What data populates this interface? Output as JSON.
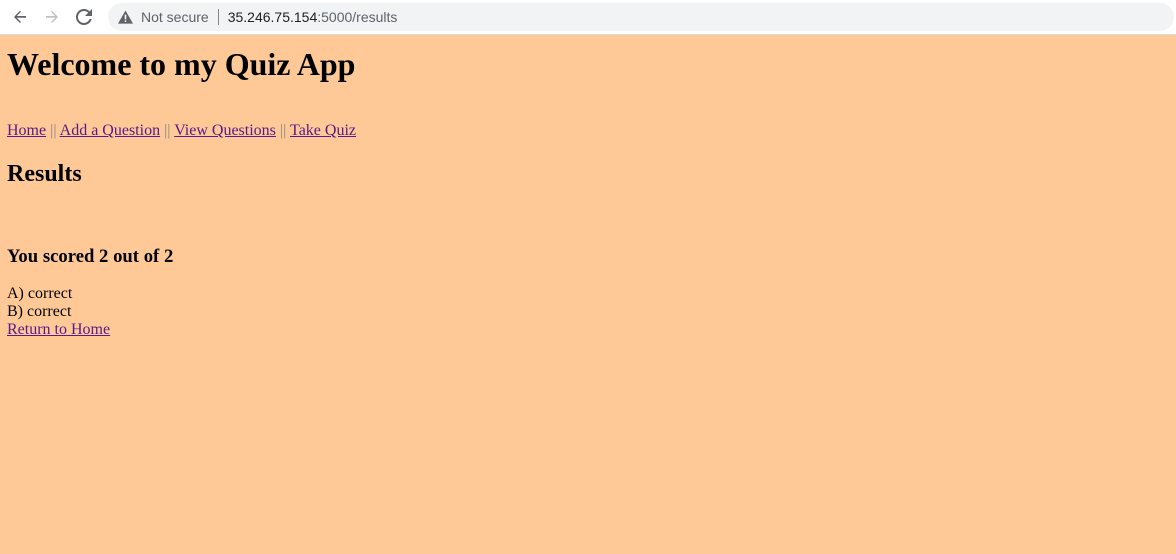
{
  "browser": {
    "security_label": "Not secure",
    "url_host": "35.246.75.154",
    "url_rest": ":5000/results"
  },
  "page": {
    "title": "Welcome to my Quiz App",
    "nav": {
      "home": "Home",
      "add_question": "Add a Question",
      "view_questions": "View Questions",
      "take_quiz": "Take Quiz",
      "divider": "||"
    },
    "heading": "Results",
    "score_text": "You scored 2 out of 2",
    "results": [
      "A) correct",
      "B) correct"
    ],
    "return_link": "Return to Home"
  },
  "colors": {
    "page_background": "#fec996",
    "visited_link": "#551a8b"
  }
}
